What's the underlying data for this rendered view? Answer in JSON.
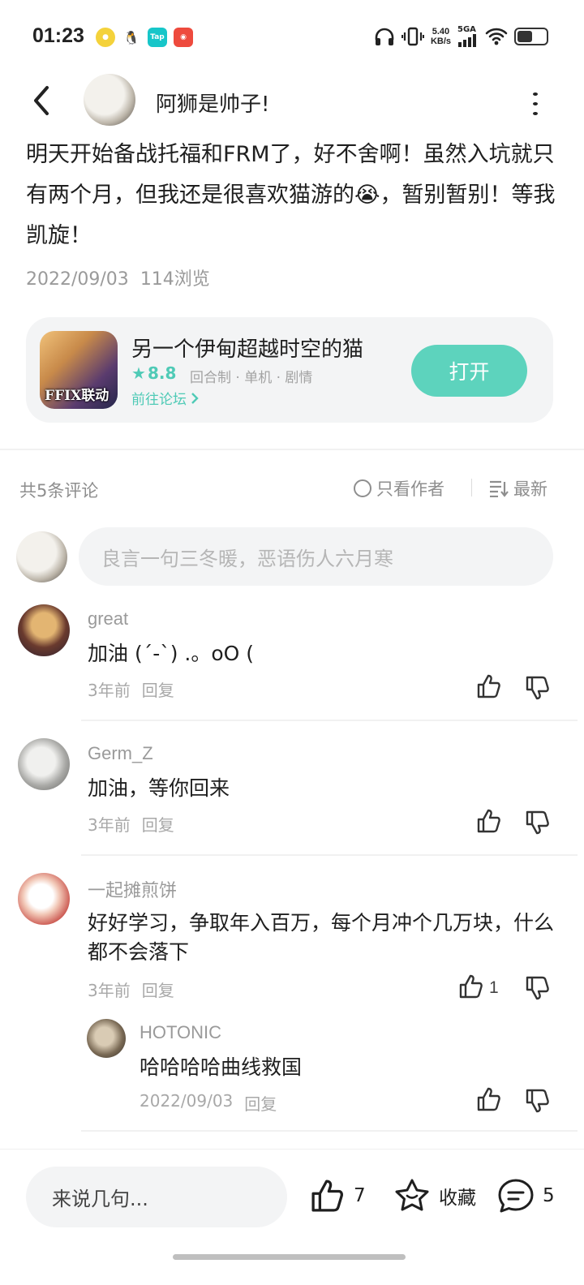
{
  "status_bar": {
    "time": "01:23",
    "net_speed_value": "5.40",
    "net_speed_unit": "KB/s",
    "network": "5GA"
  },
  "post": {
    "author": "阿狮是帅子!",
    "text": "明天开始备战托福和FRM了，好不舍啊！虽然入坑就只有两个月，但我还是很喜欢猫游的😭，暂别暂别！等我凯旋！",
    "date": "2022/09/03",
    "views": "114浏览"
  },
  "game_card": {
    "icon_text": "FFIX联动",
    "title": "另一个伊甸超越时空的猫",
    "rating": "8.8",
    "tags": "回合制 · 单机 · 剧情",
    "forum_link": "前往论坛",
    "open_label": "打开"
  },
  "comments_header": {
    "count": "共5条评论",
    "author_only": "只看作者",
    "sort": "最新"
  },
  "comment_input_placeholder": "良言一句三冬暖，恶语伤人六月寒",
  "comments": [
    {
      "user": "great",
      "text": "加油 (´-`) .。oO (",
      "time": "3年前",
      "reply": "回复",
      "likes": ""
    },
    {
      "user": "Germ_Z",
      "text": "加油，等你回来",
      "time": "3年前",
      "reply": "回复",
      "likes": ""
    },
    {
      "user": "一起摊煎饼",
      "text": "好好学习，争取年入百万，每个月冲个几万块，什么都不会落下",
      "time": "3年前",
      "reply": "回复",
      "likes": "1"
    }
  ],
  "sub_reply": {
    "user": "HOTONIC",
    "text": "哈哈哈哈曲线救国",
    "time": "2022/09/03",
    "reply": "回复"
  },
  "bottom_bar": {
    "input_placeholder": "来说几句...",
    "like_count": "7",
    "favorite_label": "收藏",
    "comment_count": "5"
  }
}
